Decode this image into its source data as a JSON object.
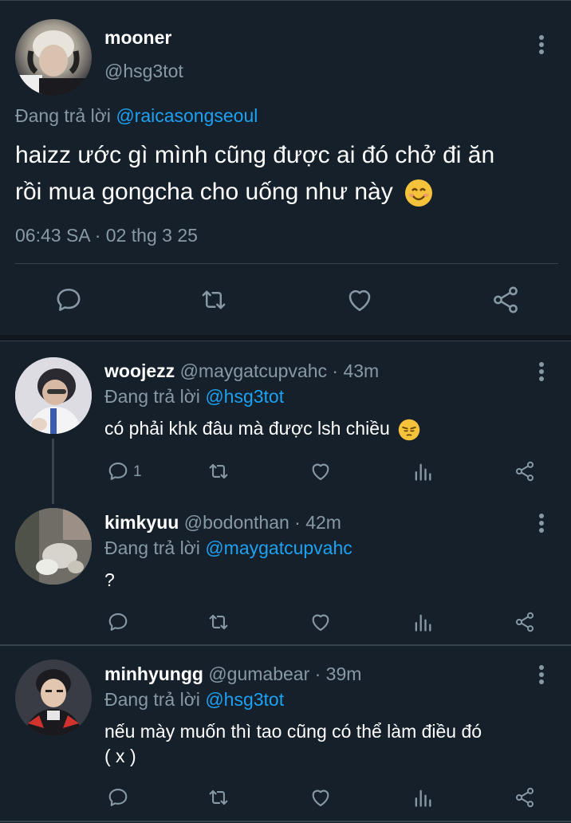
{
  "main_tweet": {
    "author_name": "mooner",
    "author_handle": "@hsg3tot",
    "reply_prefix": "Đang trả lời ",
    "reply_to": "@raicasongseoul",
    "text_line1": "haizz ước gì mình cũng được ai đó chở đi ăn",
    "text_line2": "rồi mua gongcha cho uống như này",
    "timestamp": "06:43 SA · 02 thg 3 25",
    "actions": [
      "reply-icon",
      "retweet-icon",
      "like-icon",
      "share-icon"
    ]
  },
  "replies": [
    {
      "author_name": "woojezz",
      "author_handle_time": "@maygatcupvahc · 43m",
      "reply_prefix": "Đang trả lời ",
      "reply_to": "@hsg3tot",
      "text": "có phải khk đâu mà được lsh chiều",
      "reply_count": "1"
    },
    {
      "author_name": "kimkyuu",
      "author_handle_time": "@bodonthan · 42m",
      "reply_prefix": "Đang trả lời ",
      "reply_to": "@maygatcupvahc",
      "text": "?",
      "reply_count": ""
    },
    {
      "author_name": "minhyungg",
      "author_handle_time": "@gumabear · 39m",
      "reply_prefix": "Đang trả lời ",
      "reply_to": "@hsg3tot",
      "text_line1": "nếu mày muốn thì tao cũng có thể làm điều đó",
      "text_line2": "( x )",
      "reply_count": ""
    }
  ],
  "colors": {
    "background": "#15202b",
    "divider": "#38444d",
    "secondary_text": "#8899a6",
    "link": "#1da1f2"
  }
}
